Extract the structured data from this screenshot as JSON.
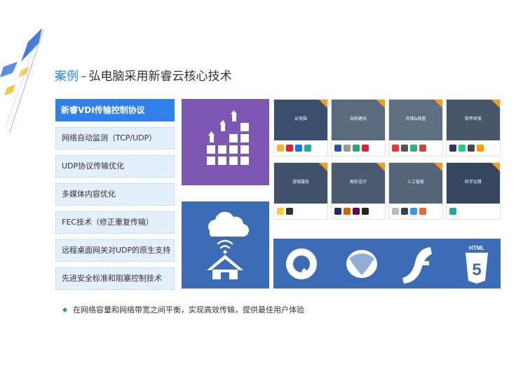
{
  "title": {
    "highlight": "案例",
    "separator": "–",
    "text": "弘电脑采用新睿云核心技术"
  },
  "menu": [
    {
      "label": "新睿VDI传输控制协议",
      "active": true
    },
    {
      "label": "网络自动监测（TCP/UDP）",
      "active": false
    },
    {
      "label": "UDP协议传输优化",
      "active": false
    },
    {
      "label": "多媒体内容优化",
      "active": false
    },
    {
      "label": "FEC技术（修正重复传输）",
      "active": false
    },
    {
      "label": "远程桌面网关对UDP的原生支持",
      "active": false
    },
    {
      "label": "先进安全标准和阻塞控制技术",
      "active": false
    }
  ],
  "cards": [
    {
      "label": "云电脑",
      "bg": "#3a4f6e"
    },
    {
      "label": "自助建站",
      "bg": "#5a6b80"
    },
    {
      "label": "存储&网盘",
      "bg": "#5f6f82"
    },
    {
      "label": "软件研发",
      "bg": "#48566a"
    },
    {
      "label": "游戏服务",
      "bg": "#41536a"
    },
    {
      "label": "图形设计",
      "bg": "#4a5a70"
    },
    {
      "label": "人工智能",
      "bg": "#556579"
    },
    {
      "label": "科学运算",
      "bg": "#34475f"
    }
  ],
  "bullet": "在网络容量和网络带宽之间平衡，实现高效传输，提供最佳用户体验",
  "colors": {
    "accent": "#2f80e8",
    "purple": "#7e57b4",
    "blue": "#3b6cb5"
  },
  "icons": {
    "purple_tile": "bar-growth-icon",
    "blue_tile": "cloud-home-icon",
    "logos": [
      "quicktime-icon",
      "silverlight-icon",
      "flash-icon",
      "html5-icon"
    ]
  }
}
